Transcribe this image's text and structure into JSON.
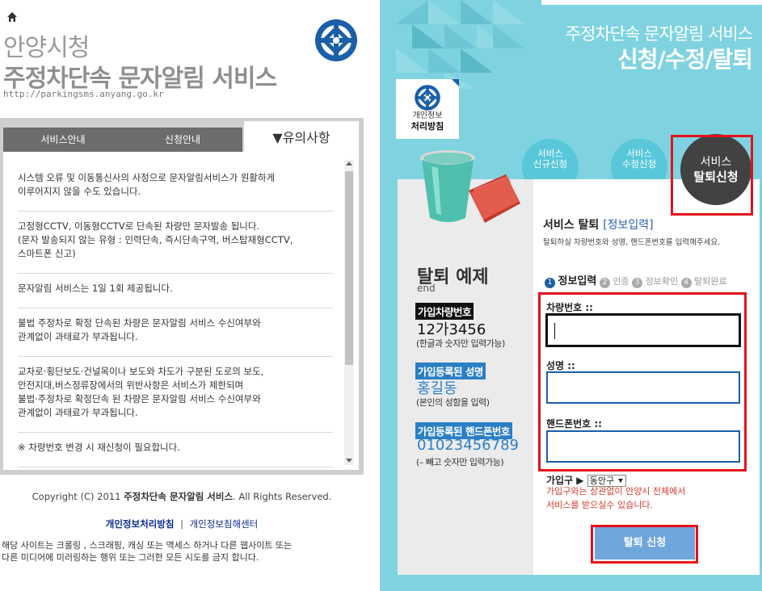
{
  "left": {
    "city_name": "안양시청",
    "service_title": "주정차단속 문자알림 서비스",
    "url": "http://parkingsms.anyang.go.kr",
    "tabs": [
      {
        "label": "서비스안내"
      },
      {
        "label": "신청안내"
      }
    ],
    "active_tab": "▼유의사항",
    "notices": [
      "시스템 오류 및 이동통신사의 사정으로 문자알림서비스가 원활하게\n이루어지지 않을 수도 있습니다.",
      "고정형CCTV, 이동형CCTV로 단속된 차량만 문자발송 됩니다.\n(문자 발송되지 않는 유형 : 인력단속, 즉시단속구역, 버스탑재형CCTV,\n스마트폰 신고)",
      "문자알림 서비스는 1일 1회 제공됩니다.",
      "불법 주정차로 확정 단속된 차량은 문자알림 서비스 수신여부와\n관계없이 과태료가 부과됩니다.",
      "교차로·횡단보도·건널목이나 보도와 차도가 구분된 도로의 보도,\n안전지대,버스정류장에서의 위반사항은 서비스가 제한되며\n불법·주정차로 확정단속 된 차량은 문자알림 서비스 수신여부와\n관계없이 과태료가 부과됩니다.",
      "※ 차량번호 변경 시 재신청이 필요합니다."
    ],
    "copyright_prefix": "Copyright (C) 2011 ",
    "copyright_bold": "주정차단속 문자알림 서비스",
    "copyright_suffix": ". All Rights Reserved.",
    "footer_link_privacy": "개인정보처리방침",
    "footer_sep": "|",
    "footer_link_center": "개인정보침해센터",
    "footer_notice": "해당 사이트는 크롤링 , 스크래핑, 캐싱 또는 액세스 하거나 다른 웹사이트 또는\n다른 미디어에 미러링하는 행위 또는 그러한 모든 시도를 금지 합니다."
  },
  "right": {
    "header_sub": "주정차단속 문자알림 서비스",
    "header_main": "신청/수정/탈퇴",
    "privacy_line1": "개인정보",
    "privacy_line2": "처리방침",
    "step_tabs": [
      {
        "line1": "서비스",
        "line2": "신규신청"
      },
      {
        "line1": "서비스",
        "line2": "수정신청"
      }
    ],
    "active_step": {
      "line1": "서비스",
      "line2": "탈퇴신청"
    },
    "example": {
      "title": "탈퇴 예제",
      "sub": "end",
      "car_label": "가입차량번호",
      "car_value": "12가3456",
      "car_note": "(한글과 숫자만 입력가능)",
      "name_label": "가입등록된 성명",
      "name_value": "홍길동",
      "name_note": "(본인의 성함을 입력)",
      "phone_label": "가입등록된 핸드폰번호",
      "phone_value": "01023456789",
      "phone_note": "(– 빼고 숫자만 입력가능)"
    },
    "form": {
      "title": "서비스 탈퇴 ",
      "title_bracket": "[정보입력]",
      "desc": "탈퇴하실 차량번호와 성명, 핸드폰번호를 입력해주세요.",
      "steps": [
        "정보입력",
        "인증",
        "정보확인",
        "탈퇴완료"
      ],
      "step_nums": [
        "1",
        "2",
        "3",
        "4"
      ],
      "car_label": "차량번호 ::",
      "name_label": "성명 ::",
      "phone_label": "핸드폰번호 ::",
      "car_value": "",
      "name_value": "",
      "phone_value": "",
      "district_label": "가입구 ▶",
      "district_value": "동안구",
      "district_note": "가입구와는 상관없이 안양시 전체에서\n서비스를 받으실수 있습니다.",
      "submit_label": "탈퇴 신청"
    },
    "colors": {
      "bg": "#7fd3e0",
      "tab": "#57c7d9",
      "active": "#424242",
      "highlight": "#e3121b",
      "button": "#6fa6dc"
    }
  }
}
